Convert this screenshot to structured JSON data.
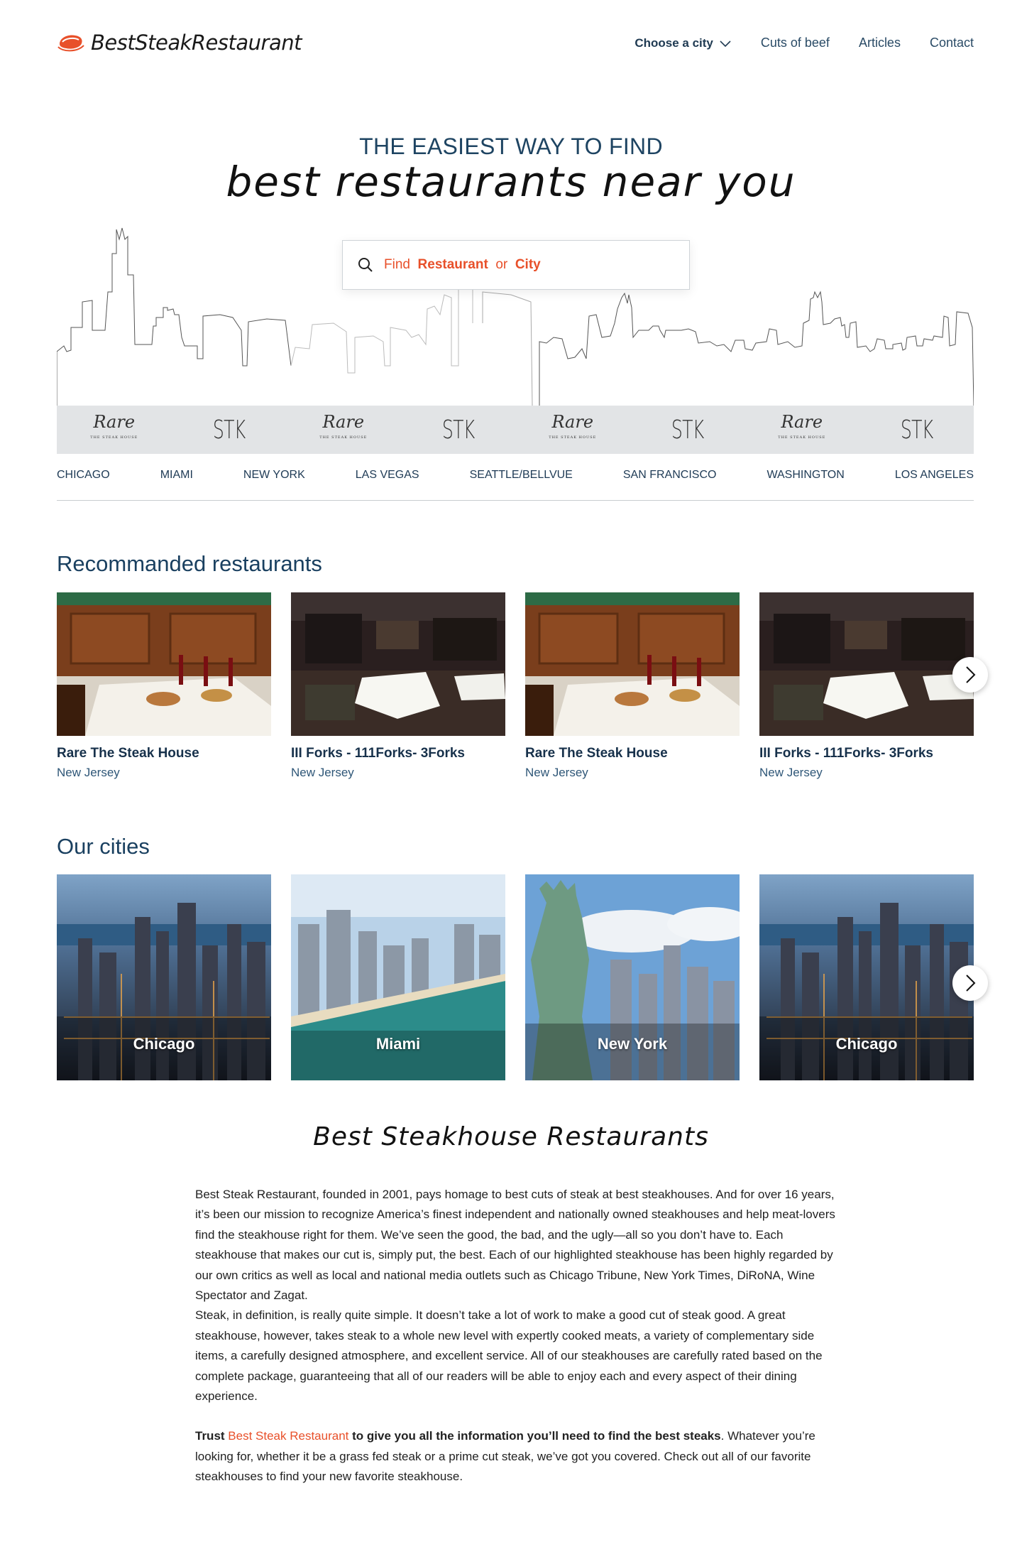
{
  "header": {
    "logo_text": "BestSteakRestaurant",
    "nav": [
      {
        "label": "Choose a city"
      },
      {
        "label": "Cuts of beef"
      },
      {
        "label": "Articles"
      },
      {
        "label": "Contact"
      }
    ]
  },
  "hero": {
    "eyebrow": "THE EASIEST WAY TO FIND",
    "title": "best restaurants near you",
    "search": {
      "prefix": "Find",
      "restaurant": "Restaurant",
      "or": "or",
      "city": "City"
    }
  },
  "brands": [
    {
      "type": "rare",
      "name": "Rare",
      "tag": "THE STEAK HOUSE"
    },
    {
      "type": "stk",
      "name": "STK"
    },
    {
      "type": "rare",
      "name": "Rare",
      "tag": "THE STEAK HOUSE"
    },
    {
      "type": "stk",
      "name": "STK"
    },
    {
      "type": "rare",
      "name": "Rare",
      "tag": "THE STEAK HOUSE"
    },
    {
      "type": "stk",
      "name": "STK"
    },
    {
      "type": "rare",
      "name": "Rare",
      "tag": "THE STEAK HOUSE"
    },
    {
      "type": "stk",
      "name": "STK"
    }
  ],
  "city_links": [
    "CHICAGO",
    "MIAMI",
    "NEW YORK",
    "LAS VEGAS",
    "SEATTLE/BELLVUE",
    "SAN FRANCISCO",
    "WASHINGTON",
    "LOS ANGELES"
  ],
  "recommended": {
    "title": "Recommanded restaurants",
    "items": [
      {
        "name": "Rare The Steak House",
        "location": "New Jersey"
      },
      {
        "name": "III Forks - 111Forks- 3Forks",
        "location": "New Jersey"
      },
      {
        "name": "Rare The Steak House",
        "location": "New Jersey"
      },
      {
        "name": "III Forks - 111Forks- 3Forks",
        "location": "New Jersey"
      }
    ]
  },
  "cities": {
    "title": "Our cities",
    "items": [
      {
        "name": "Chicago"
      },
      {
        "name": "Miami"
      },
      {
        "name": "New York"
      },
      {
        "name": "Chicago"
      }
    ]
  },
  "about": {
    "title": "Best Steakhouse Restaurants",
    "p1": "Best Steak Restaurant, founded in 2001, pays homage to best cuts of steak at best steakhouses. And for over 16 years, it’s been our mission to recognize America’s finest independent and nationally owned steakhouses and help meat-lovers find the steakhouse right for them. We’ve seen the good, the bad, and the ugly—all so you don’t have to. Each steakhouse that makes our cut is, simply put, the best. Each of our highlighted steakhouse has been highly regarded by our own critics as well as local and national media outlets such as Chicago Tribune, New York Times, DiRoNA, Wine Spectator and Zagat.",
    "p2": "Steak, in definition, is really quite simple. It doesn’t take a lot of work to make a good cut of steak good. A great steakhouse, however, takes steak to a whole new level with expertly cooked meats, a variety of complementary side items, a carefully designed atmosphere, and excellent service. All of our steakhouses are carefully rated based on the complete package, guaranteeing that all of our readers will be able to enjoy each and every aspect of their dining experience.",
    "p3_trust": "Trust",
    "p3_link": "Best Steak Restaurant",
    "p3_bold": "to give you all the information you’ll need to find the best steaks",
    "p3_rest": ". Whatever you’re looking for, whether it be a grass fed steak or a prime cut steak, we’ve got you covered. Check out all of our favorite steakhouses to find your new favorite steakhouse."
  },
  "colors": {
    "accent": "#e8502a",
    "navy": "#1d3548",
    "strip": "#e2e4e6"
  }
}
